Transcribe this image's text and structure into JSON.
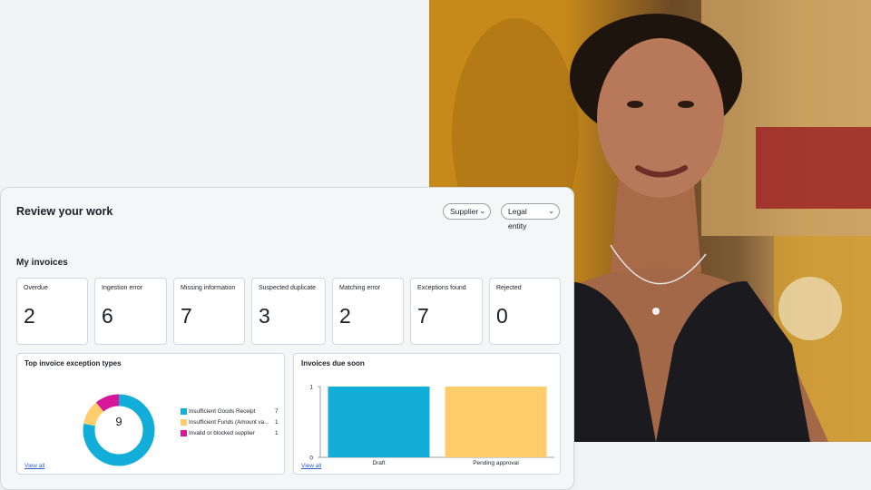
{
  "header": {
    "title": "Review your work"
  },
  "filters": {
    "supplier": "Supplier",
    "legal_entity": "Legal entity"
  },
  "invoices": {
    "title": "My invoices",
    "tiles": [
      {
        "label": "Overdue",
        "value": "2"
      },
      {
        "label": "Ingestion error",
        "value": "6"
      },
      {
        "label": "Missing information",
        "value": "7"
      },
      {
        "label": "Suspected duplicate",
        "value": "3"
      },
      {
        "label": "Matching error",
        "value": "2"
      },
      {
        "label": "Exceptions found",
        "value": "7"
      },
      {
        "label": "Rejected",
        "value": "0"
      }
    ]
  },
  "exceptions_panel": {
    "title": "Top invoice exception types",
    "total": "9",
    "view_all": "View all",
    "legend": [
      {
        "label": "Insufficient Goods Receipt",
        "count": "7",
        "color": "#12aed9"
      },
      {
        "label": "Insufficient Funds (Amount va...",
        "count": "1",
        "color": "#ffcd6b"
      },
      {
        "label": "Invalid or blocked supplier",
        "count": "1",
        "color": "#d6169b"
      }
    ]
  },
  "due_panel": {
    "title": "Invoices due soon",
    "view_all": "View all"
  },
  "chart_data": [
    {
      "type": "pie",
      "title": "Top invoice exception types",
      "categories": [
        "Insufficient Goods Receipt",
        "Insufficient Funds (Amount va...",
        "Invalid or blocked supplier"
      ],
      "values": [
        7,
        1,
        1
      ],
      "colors": [
        "#12aed9",
        "#ffcd6b",
        "#d6169b"
      ],
      "center_label": "9",
      "legend": "right"
    },
    {
      "type": "bar",
      "title": "Invoices due soon",
      "categories": [
        "Draft",
        "Pending approval"
      ],
      "values": [
        1,
        1
      ],
      "colors": [
        "#12aed9",
        "#ffcd6b"
      ],
      "ylim": [
        0,
        1
      ],
      "yticks": [
        "0",
        "1"
      ]
    }
  ]
}
